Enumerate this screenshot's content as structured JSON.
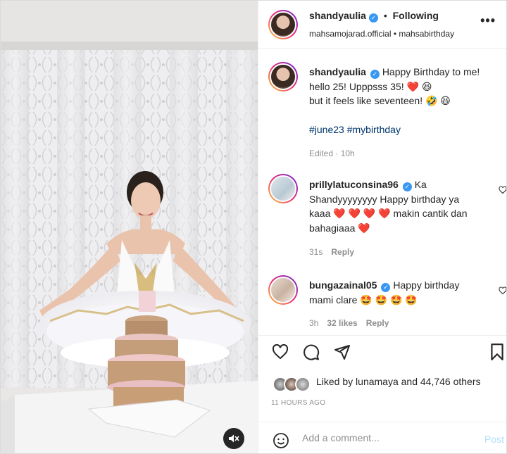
{
  "header": {
    "username": "shandyaulia",
    "following_label": "Following",
    "subtitle": "mahsamojarad.official • mahsabirthday",
    "more_label": "•••"
  },
  "caption": {
    "username": "shandyaulia",
    "line1": "Happy Birthday to me!",
    "line2": "hello 25! Upppsss 35! ❤️ 😆",
    "line3": "but it feels like seventeen! 🤣 😆",
    "hashtags": "#june23 #mybirthday",
    "edited": "Edited · 10h"
  },
  "comments": [
    {
      "username": "prillylatuconsina96",
      "text_a": "Ka",
      "text_b": "Shandyyyyyyyy Happy birthday ya",
      "text_c": "kaaa ❤️ ❤️ ❤️ ❤️ makin cantik dan",
      "text_d": "bahagiaaa ❤️",
      "time": "31s",
      "reply": "Reply"
    },
    {
      "username": "bungazainal05",
      "text_a": "Happy birthday",
      "text_b": "mami clare 🤩 🤩 🤩 🤩",
      "time": "3h",
      "likes": "32 likes",
      "reply": "Reply"
    }
  ],
  "likes": {
    "text_prefix": "Liked by",
    "user": "lunamaya",
    "text_suffix": "and 44,746 others"
  },
  "timestamp": "11 HOURS AGO",
  "comment_box": {
    "placeholder": "Add a comment...",
    "post_label": "Post"
  },
  "icons": {
    "like": "heart-icon",
    "comment": "comment-icon",
    "share": "paper-plane-icon",
    "save": "bookmark-icon",
    "emoji": "smiley-icon",
    "mute": "speaker-muted-icon",
    "more": "ellipsis-icon",
    "verified": "verified-badge-icon"
  },
  "colors": {
    "verified": "#3897f0",
    "post_disabled": "#b2dffc",
    "hashtag": "#00376b",
    "heart_red": "#ed4956"
  }
}
